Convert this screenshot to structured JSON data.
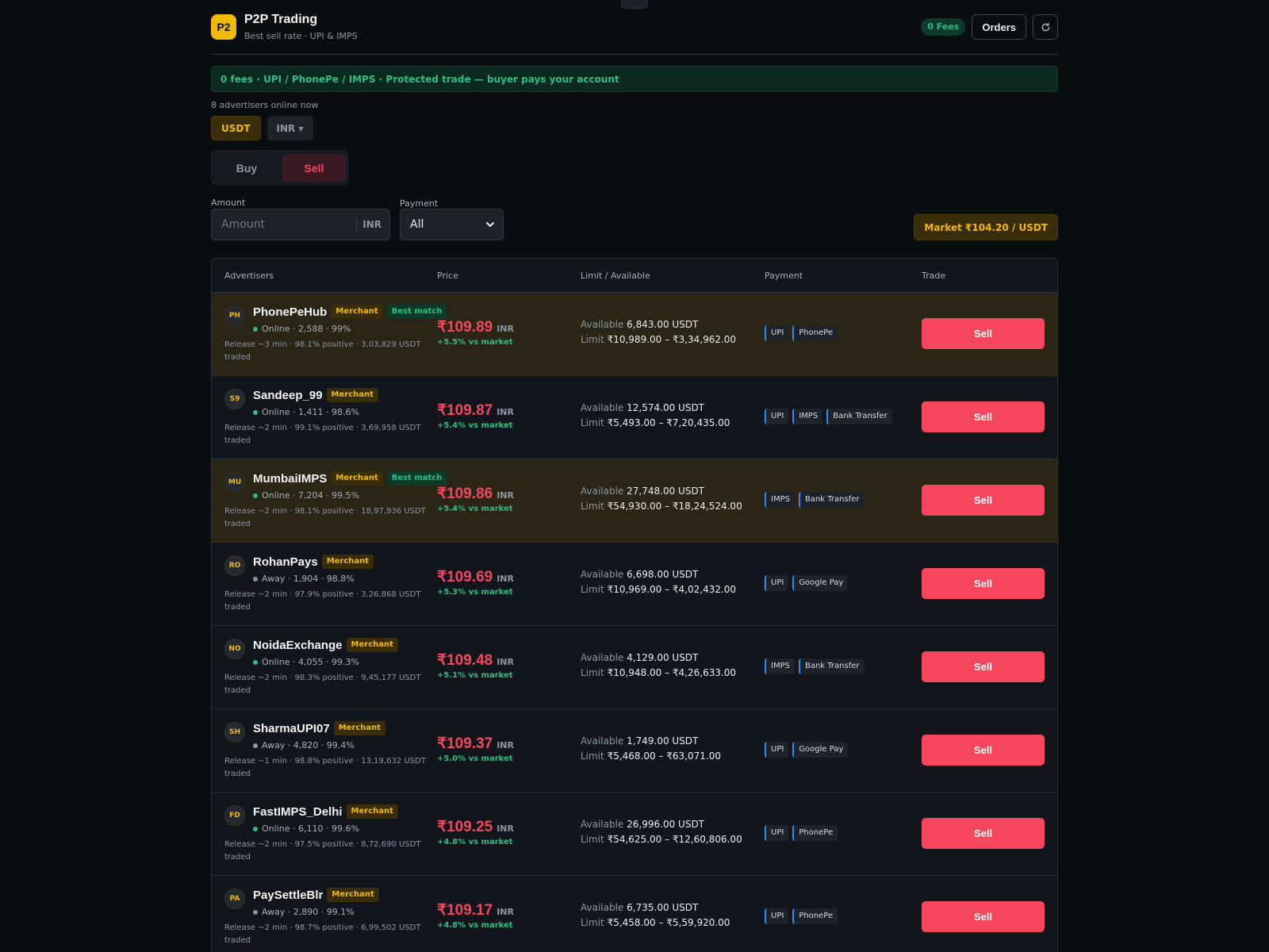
{
  "header": {
    "logo": "P2",
    "title": "P2P Trading",
    "subtitle": "Best sell rate · UPI & IMPS",
    "fees_badge": "0 Fees",
    "orders_label": "Orders",
    "refresh_icon": "refresh-icon"
  },
  "banner": "0 fees · UPI / PhonePe / IMPS · Protected trade — buyer pays your account",
  "online_count": "8 advertisers online now",
  "coins": {
    "crypto": "USDT",
    "fiat": "INR ▾"
  },
  "side": {
    "buy": "Buy",
    "sell": "Sell",
    "active": "sell"
  },
  "filters": {
    "amount_label": "Amount",
    "amount_placeholder": "Amount",
    "amount_value": "",
    "amount_currency": "INR",
    "payment_label": "Payment",
    "payment_selected": "All",
    "market": "Market ₹104.20 / USDT"
  },
  "table": {
    "headers": {
      "advertisers": "Advertisers",
      "price": "Price",
      "limit": "Limit / Available",
      "payment": "Payment",
      "trade": "Trade"
    },
    "available_label": "Available",
    "limit_label": "Limit",
    "rows": [
      {
        "initials": "PH",
        "name": "PhonePeHub",
        "merchant": "Merchant",
        "best": "Best match",
        "status": "Online",
        "online": true,
        "stats": "Online · 2,588 · 99%",
        "release": "Release ~3 min · 98.1% positive · 3,03,829 USDT traded",
        "price": "₹109.89",
        "currency": "INR",
        "diff": "+5.5% vs market",
        "available": "6,843.00 USDT",
        "limit": "₹10,989.00 – ₹3,34,962.00",
        "payments": [
          "UPI",
          "PhonePe"
        ],
        "action": "Sell"
      },
      {
        "initials": "S9",
        "name": "Sandeep_99",
        "merchant": "Merchant",
        "best": "",
        "status": "Online",
        "online": true,
        "stats": "Online · 1,411 · 98.6%",
        "release": "Release ~2 min · 99.1% positive · 3,69,958 USDT traded",
        "price": "₹109.87",
        "currency": "INR",
        "diff": "+5.4% vs market",
        "available": "12,574.00 USDT",
        "limit": "₹5,493.00 – ₹7,20,435.00",
        "payments": [
          "UPI",
          "IMPS",
          "Bank Transfer"
        ],
        "action": "Sell"
      },
      {
        "initials": "MU",
        "name": "MumbaiIMPS",
        "merchant": "Merchant",
        "best": "Best match",
        "status": "Online",
        "online": true,
        "stats": "Online · 7,204 · 99.5%",
        "release": "Release ~2 min · 98.1% positive · 18,97,936 USDT traded",
        "price": "₹109.86",
        "currency": "INR",
        "diff": "+5.4% vs market",
        "available": "27,748.00 USDT",
        "limit": "₹54,930.00 – ₹18,24,524.00",
        "payments": [
          "IMPS",
          "Bank Transfer"
        ],
        "action": "Sell"
      },
      {
        "initials": "RO",
        "name": "RohanPays",
        "merchant": "Merchant",
        "best": "",
        "status": "Away",
        "online": false,
        "stats": "Away · 1,904 · 98.8%",
        "release": "Release ~2 min · 97.9% positive · 3,26,868 USDT traded",
        "price": "₹109.69",
        "currency": "INR",
        "diff": "+5.3% vs market",
        "available": "6,698.00 USDT",
        "limit": "₹10,969.00 – ₹4,02,432.00",
        "payments": [
          "UPI",
          "Google Pay"
        ],
        "action": "Sell"
      },
      {
        "initials": "NO",
        "name": "NoidaExchange",
        "merchant": "Merchant",
        "best": "",
        "status": "Online",
        "online": true,
        "stats": "Online · 4,055 · 99.3%",
        "release": "Release ~2 min · 98.3% positive · 9,45,177 USDT traded",
        "price": "₹109.48",
        "currency": "INR",
        "diff": "+5.1% vs market",
        "available": "4,129.00 USDT",
        "limit": "₹10,948.00 – ₹4,26,633.00",
        "payments": [
          "IMPS",
          "Bank Transfer"
        ],
        "action": "Sell"
      },
      {
        "initials": "SH",
        "name": "SharmaUPI07",
        "merchant": "Merchant",
        "best": "",
        "status": "Away",
        "online": false,
        "stats": "Away · 4,820 · 99.4%",
        "release": "Release ~1 min · 98.8% positive · 13,19,632 USDT traded",
        "price": "₹109.37",
        "currency": "INR",
        "diff": "+5.0% vs market",
        "available": "1,749.00 USDT",
        "limit": "₹5,468.00 – ₹63,071.00",
        "payments": [
          "UPI",
          "Google Pay"
        ],
        "action": "Sell"
      },
      {
        "initials": "FD",
        "name": "FastIMPS_Delhi",
        "merchant": "Merchant",
        "best": "",
        "status": "Online",
        "online": true,
        "stats": "Online · 6,110 · 99.6%",
        "release": "Release ~2 min · 97.5% positive · 8,72,690 USDT traded",
        "price": "₹109.25",
        "currency": "INR",
        "diff": "+4.8% vs market",
        "available": "26,996.00 USDT",
        "limit": "₹54,625.00 – ₹12,60,806.00",
        "payments": [
          "UPI",
          "PhonePe"
        ],
        "action": "Sell"
      },
      {
        "initials": "PA",
        "name": "PaySettleBlr",
        "merchant": "Merchant",
        "best": "",
        "status": "Away",
        "online": false,
        "stats": "Away · 2,890 · 99.1%",
        "release": "Release ~2 min · 98.7% positive · 6,99,502 USDT traded",
        "price": "₹109.17",
        "currency": "INR",
        "diff": "+4.8% vs market",
        "available": "6,735.00 USDT",
        "limit": "₹5,458.00 – ₹5,59,920.00",
        "payments": [
          "UPI",
          "PhonePe"
        ],
        "action": "Sell"
      }
    ]
  },
  "colors": {
    "accent": "#f0b90b",
    "sell": "#f6465d",
    "positive": "#2ebd85",
    "background": "#0b0e11"
  }
}
